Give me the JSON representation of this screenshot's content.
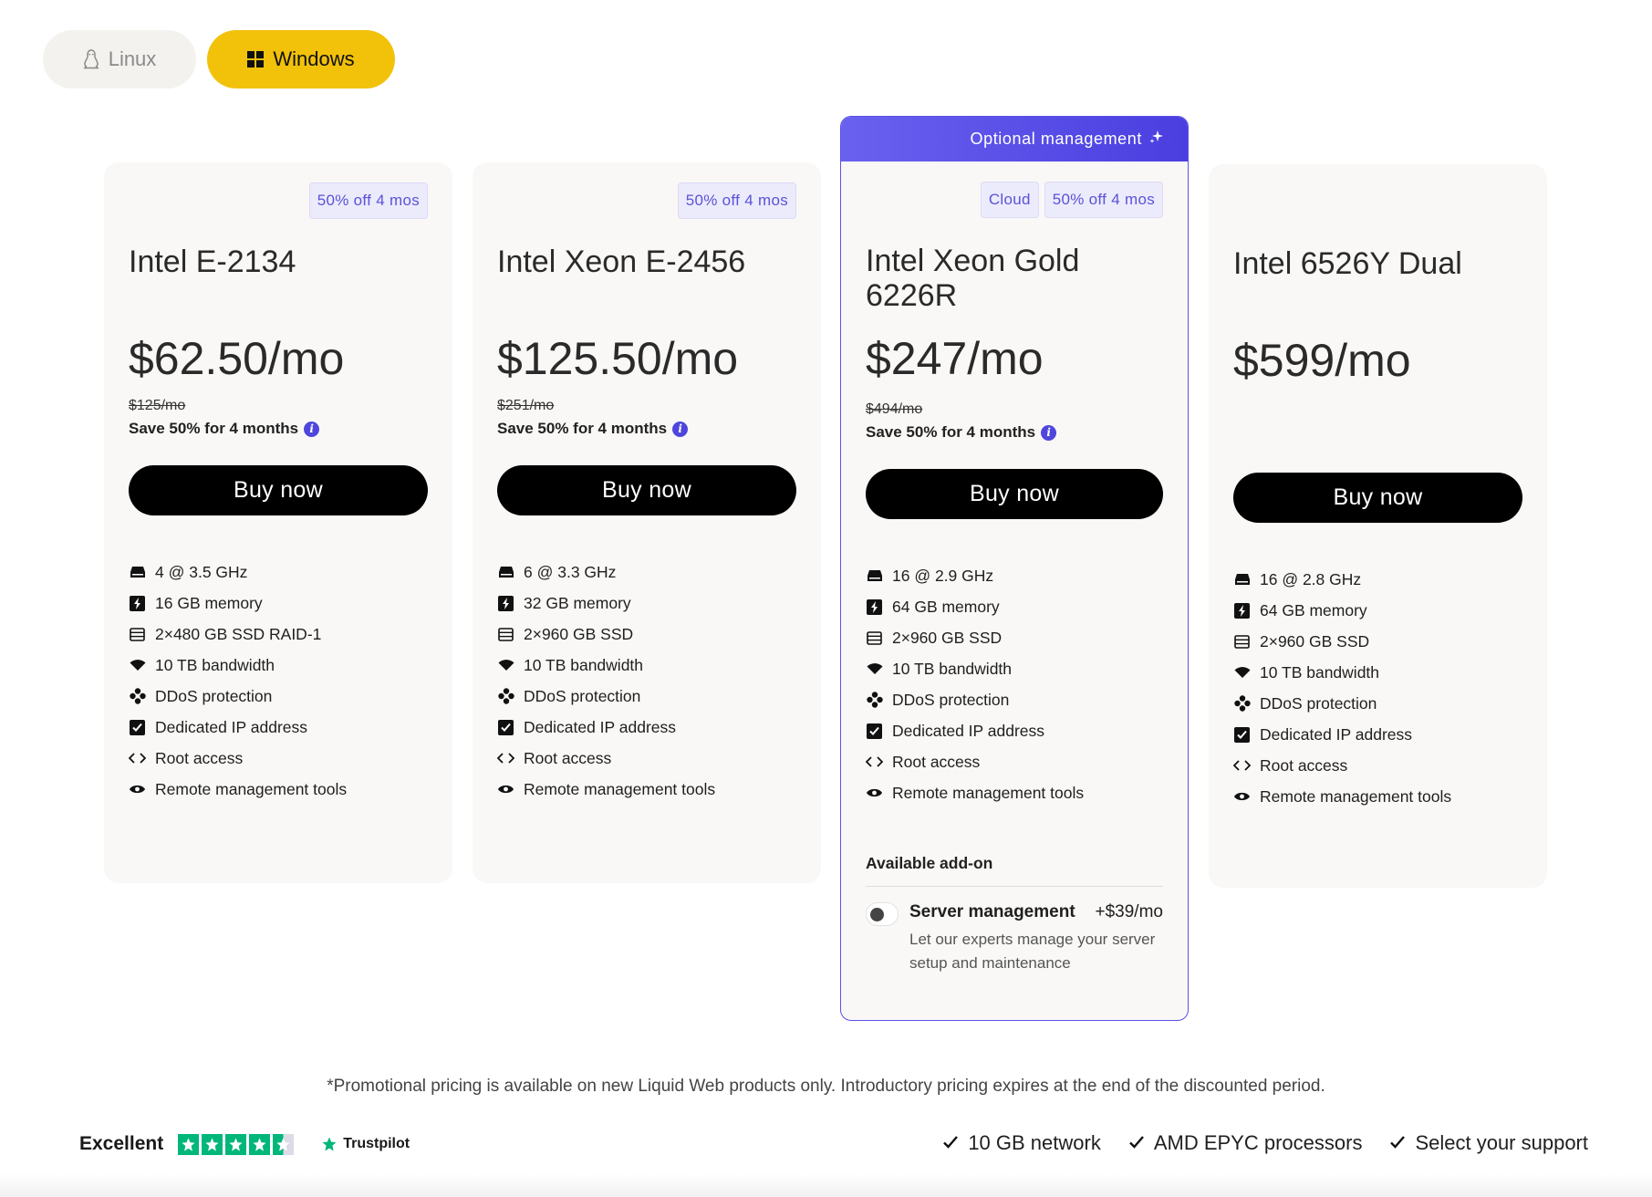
{
  "os_toggle": {
    "options": [
      {
        "label": "Linux",
        "icon": "linux-penguin-icon",
        "selected": false
      },
      {
        "label": "Windows",
        "icon": "windows-icon",
        "selected": true
      }
    ]
  },
  "plans": [
    {
      "badges": [
        "50% off 4 mos"
      ],
      "name": "Intel E-2134",
      "price": "$62.50/mo",
      "original_price": "$125/mo",
      "savings": "Save 50% for 4 months",
      "buy_label": "Buy now",
      "features": [
        {
          "icon": "cpu-icon",
          "text": "4 @ 3.5 GHz"
        },
        {
          "icon": "memory-icon",
          "text": "16 GB memory"
        },
        {
          "icon": "storage-icon",
          "text": "2×480 GB SSD RAID-1"
        },
        {
          "icon": "bandwidth-icon",
          "text": "10 TB bandwidth"
        },
        {
          "icon": "ddos-icon",
          "text": "DDoS protection"
        },
        {
          "icon": "checkbox-icon",
          "text": "Dedicated IP address"
        },
        {
          "icon": "code-icon",
          "text": "Root access"
        },
        {
          "icon": "eye-icon",
          "text": "Remote management tools"
        }
      ]
    },
    {
      "badges": [
        "50% off 4 mos"
      ],
      "name": "Intel Xeon E-2456",
      "price": "$125.50/mo",
      "original_price": "$251/mo",
      "savings": "Save 50% for 4 months",
      "buy_label": "Buy now",
      "features": [
        {
          "icon": "cpu-icon",
          "text": "6 @ 3.3 GHz"
        },
        {
          "icon": "memory-icon",
          "text": "32 GB memory"
        },
        {
          "icon": "storage-icon",
          "text": "2×960 GB SSD"
        },
        {
          "icon": "bandwidth-icon",
          "text": "10 TB bandwidth"
        },
        {
          "icon": "ddos-icon",
          "text": "DDoS protection"
        },
        {
          "icon": "checkbox-icon",
          "text": "Dedicated IP address"
        },
        {
          "icon": "code-icon",
          "text": "Root access"
        },
        {
          "icon": "eye-icon",
          "text": "Remote management tools"
        }
      ]
    },
    {
      "banner": "Optional management",
      "badges": [
        "Cloud",
        "50% off 4 mos"
      ],
      "name": "Intel Xeon Gold 6226R",
      "price": "$247/mo",
      "original_price": "$494/mo",
      "savings": "Save 50% for 4 months",
      "buy_label": "Buy now",
      "features": [
        {
          "icon": "cpu-icon",
          "text": "16 @ 2.9 GHz"
        },
        {
          "icon": "memory-icon",
          "text": "64 GB memory"
        },
        {
          "icon": "storage-icon",
          "text": "2×960 GB SSD"
        },
        {
          "icon": "bandwidth-icon",
          "text": "10 TB bandwidth"
        },
        {
          "icon": "ddos-icon",
          "text": "DDoS protection"
        },
        {
          "icon": "checkbox-icon",
          "text": "Dedicated IP address"
        },
        {
          "icon": "code-icon",
          "text": "Root access"
        },
        {
          "icon": "eye-icon",
          "text": "Remote management tools"
        }
      ],
      "addon": {
        "title": "Available add-on",
        "name": "Server management",
        "price": "+$39/mo",
        "description": "Let our experts manage your server setup and maintenance",
        "enabled": false
      }
    },
    {
      "badges": [],
      "name": "Intel 6526Y Dual",
      "price": "$599/mo",
      "original_price": "",
      "savings": "",
      "buy_label": "Buy now",
      "features": [
        {
          "icon": "cpu-icon",
          "text": "16 @ 2.8 GHz"
        },
        {
          "icon": "memory-icon",
          "text": "64 GB memory"
        },
        {
          "icon": "storage-icon",
          "text": "2×960 GB SSD"
        },
        {
          "icon": "bandwidth-icon",
          "text": "10 TB bandwidth"
        },
        {
          "icon": "ddos-icon",
          "text": "DDoS protection"
        },
        {
          "icon": "checkbox-icon",
          "text": "Dedicated IP address"
        },
        {
          "icon": "code-icon",
          "text": "Root access"
        },
        {
          "icon": "eye-icon",
          "text": "Remote management tools"
        }
      ]
    }
  ],
  "promo_note": "*Promotional pricing is available on new Liquid Web products only. Introductory pricing expires at the end of the discounted period.",
  "footer": {
    "rating_word": "Excellent",
    "stars": 4.5,
    "review_brand": "Trustpilot",
    "checks": [
      "10 GB network",
      "AMD EPYC processors",
      "Select your support"
    ]
  },
  "colors": {
    "accent_yellow": "#f2c10a",
    "accent_purple": "#5b50e6",
    "trustpilot_green": "#00b67a",
    "button_black": "#000000"
  }
}
